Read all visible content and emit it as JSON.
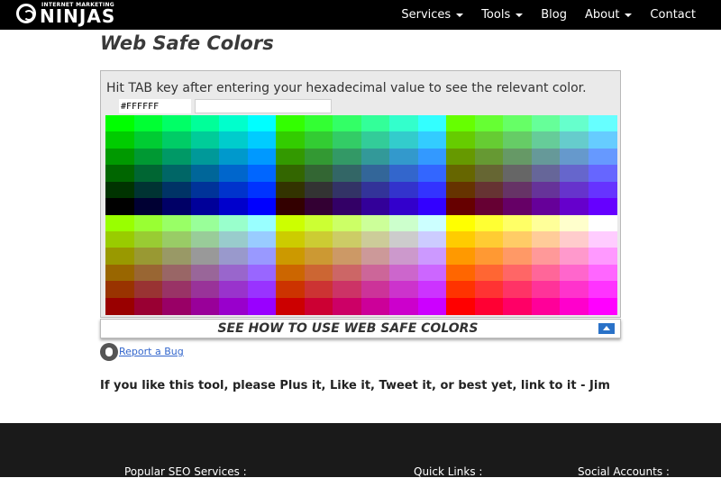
{
  "logo": {
    "small_text": "INTERNET MARKETING",
    "big_text": "NINJAS"
  },
  "nav": {
    "services": "Services",
    "tools": "Tools",
    "blog": "Blog",
    "about": "About",
    "contact": "Contact"
  },
  "page": {
    "title": "Web Safe Colors"
  },
  "tool": {
    "instruction": "Hit TAB key after entering your hexadecimal value to see the relevant color.",
    "hex_value": "#FFFFFF",
    "preview_color": "#FFFFFF",
    "grid_cols": 18,
    "grid_rows": 12
  },
  "howto": {
    "label": "SEE HOW TO USE WEB SAFE COLORS",
    "toggle_icon": "arrow-up-icon"
  },
  "bug": {
    "icon": "bug-icon",
    "link": "Report a Bug"
  },
  "share": {
    "text": "If you like this tool, please Plus it, Like it, Tweet it, or best yet, link to it - Jim"
  },
  "footer": {
    "popular": "Popular SEO Services :",
    "quick": "Quick Links :",
    "social": "Social Accounts :"
  }
}
